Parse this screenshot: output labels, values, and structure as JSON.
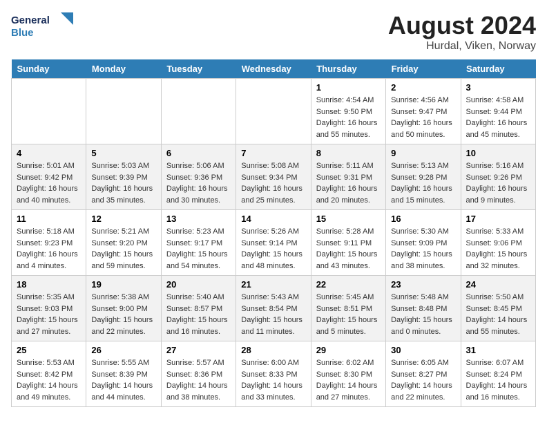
{
  "header": {
    "logo_line1": "General",
    "logo_line2": "Blue",
    "title": "August 2024",
    "subtitle": "Hurdal, Viken, Norway"
  },
  "days_of_week": [
    "Sunday",
    "Monday",
    "Tuesday",
    "Wednesday",
    "Thursday",
    "Friday",
    "Saturday"
  ],
  "weeks": [
    [
      {
        "day": "",
        "info": ""
      },
      {
        "day": "",
        "info": ""
      },
      {
        "day": "",
        "info": ""
      },
      {
        "day": "",
        "info": ""
      },
      {
        "day": "1",
        "info": "Sunrise: 4:54 AM\nSunset: 9:50 PM\nDaylight: 16 hours\nand 55 minutes."
      },
      {
        "day": "2",
        "info": "Sunrise: 4:56 AM\nSunset: 9:47 PM\nDaylight: 16 hours\nand 50 minutes."
      },
      {
        "day": "3",
        "info": "Sunrise: 4:58 AM\nSunset: 9:44 PM\nDaylight: 16 hours\nand 45 minutes."
      }
    ],
    [
      {
        "day": "4",
        "info": "Sunrise: 5:01 AM\nSunset: 9:42 PM\nDaylight: 16 hours\nand 40 minutes."
      },
      {
        "day": "5",
        "info": "Sunrise: 5:03 AM\nSunset: 9:39 PM\nDaylight: 16 hours\nand 35 minutes."
      },
      {
        "day": "6",
        "info": "Sunrise: 5:06 AM\nSunset: 9:36 PM\nDaylight: 16 hours\nand 30 minutes."
      },
      {
        "day": "7",
        "info": "Sunrise: 5:08 AM\nSunset: 9:34 PM\nDaylight: 16 hours\nand 25 minutes."
      },
      {
        "day": "8",
        "info": "Sunrise: 5:11 AM\nSunset: 9:31 PM\nDaylight: 16 hours\nand 20 minutes."
      },
      {
        "day": "9",
        "info": "Sunrise: 5:13 AM\nSunset: 9:28 PM\nDaylight: 16 hours\nand 15 minutes."
      },
      {
        "day": "10",
        "info": "Sunrise: 5:16 AM\nSunset: 9:26 PM\nDaylight: 16 hours\nand 9 minutes."
      }
    ],
    [
      {
        "day": "11",
        "info": "Sunrise: 5:18 AM\nSunset: 9:23 PM\nDaylight: 16 hours\nand 4 minutes."
      },
      {
        "day": "12",
        "info": "Sunrise: 5:21 AM\nSunset: 9:20 PM\nDaylight: 15 hours\nand 59 minutes."
      },
      {
        "day": "13",
        "info": "Sunrise: 5:23 AM\nSunset: 9:17 PM\nDaylight: 15 hours\nand 54 minutes."
      },
      {
        "day": "14",
        "info": "Sunrise: 5:26 AM\nSunset: 9:14 PM\nDaylight: 15 hours\nand 48 minutes."
      },
      {
        "day": "15",
        "info": "Sunrise: 5:28 AM\nSunset: 9:11 PM\nDaylight: 15 hours\nand 43 minutes."
      },
      {
        "day": "16",
        "info": "Sunrise: 5:30 AM\nSunset: 9:09 PM\nDaylight: 15 hours\nand 38 minutes."
      },
      {
        "day": "17",
        "info": "Sunrise: 5:33 AM\nSunset: 9:06 PM\nDaylight: 15 hours\nand 32 minutes."
      }
    ],
    [
      {
        "day": "18",
        "info": "Sunrise: 5:35 AM\nSunset: 9:03 PM\nDaylight: 15 hours\nand 27 minutes."
      },
      {
        "day": "19",
        "info": "Sunrise: 5:38 AM\nSunset: 9:00 PM\nDaylight: 15 hours\nand 22 minutes."
      },
      {
        "day": "20",
        "info": "Sunrise: 5:40 AM\nSunset: 8:57 PM\nDaylight: 15 hours\nand 16 minutes."
      },
      {
        "day": "21",
        "info": "Sunrise: 5:43 AM\nSunset: 8:54 PM\nDaylight: 15 hours\nand 11 minutes."
      },
      {
        "day": "22",
        "info": "Sunrise: 5:45 AM\nSunset: 8:51 PM\nDaylight: 15 hours\nand 5 minutes."
      },
      {
        "day": "23",
        "info": "Sunrise: 5:48 AM\nSunset: 8:48 PM\nDaylight: 15 hours\nand 0 minutes."
      },
      {
        "day": "24",
        "info": "Sunrise: 5:50 AM\nSunset: 8:45 PM\nDaylight: 14 hours\nand 55 minutes."
      }
    ],
    [
      {
        "day": "25",
        "info": "Sunrise: 5:53 AM\nSunset: 8:42 PM\nDaylight: 14 hours\nand 49 minutes."
      },
      {
        "day": "26",
        "info": "Sunrise: 5:55 AM\nSunset: 8:39 PM\nDaylight: 14 hours\nand 44 minutes."
      },
      {
        "day": "27",
        "info": "Sunrise: 5:57 AM\nSunset: 8:36 PM\nDaylight: 14 hours\nand 38 minutes."
      },
      {
        "day": "28",
        "info": "Sunrise: 6:00 AM\nSunset: 8:33 PM\nDaylight: 14 hours\nand 33 minutes."
      },
      {
        "day": "29",
        "info": "Sunrise: 6:02 AM\nSunset: 8:30 PM\nDaylight: 14 hours\nand 27 minutes."
      },
      {
        "day": "30",
        "info": "Sunrise: 6:05 AM\nSunset: 8:27 PM\nDaylight: 14 hours\nand 22 minutes."
      },
      {
        "day": "31",
        "info": "Sunrise: 6:07 AM\nSunset: 8:24 PM\nDaylight: 14 hours\nand 16 minutes."
      }
    ]
  ]
}
